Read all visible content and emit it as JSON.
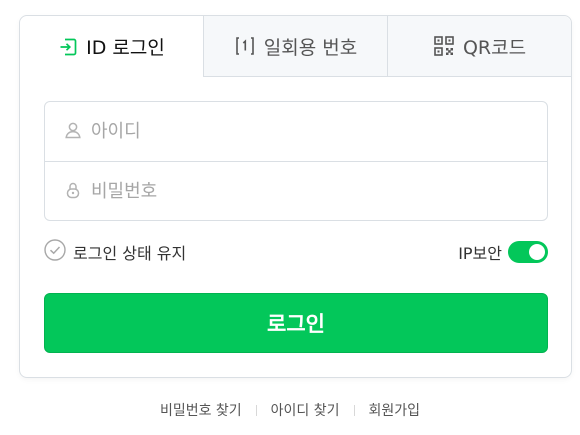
{
  "tabs": [
    {
      "label": "ID 로그인",
      "icon": "id-login-icon",
      "active": true
    },
    {
      "label": "일회용 번호",
      "icon": "one-time-number-icon",
      "active": false
    },
    {
      "label": "QR코드",
      "icon": "qr-code-icon",
      "active": false
    }
  ],
  "form": {
    "id_placeholder": "아이디",
    "password_placeholder": "비밀번호"
  },
  "options": {
    "keep_login_label": "로그인 상태 유지",
    "ip_security_label": "IP보안",
    "ip_security_on": true
  },
  "login_button": "로그인",
  "footer_links": [
    "비밀번호 찾기",
    "아이디 찾기",
    "회원가입"
  ],
  "colors": {
    "accent": "#03c75a",
    "border": "#dadfe4"
  }
}
